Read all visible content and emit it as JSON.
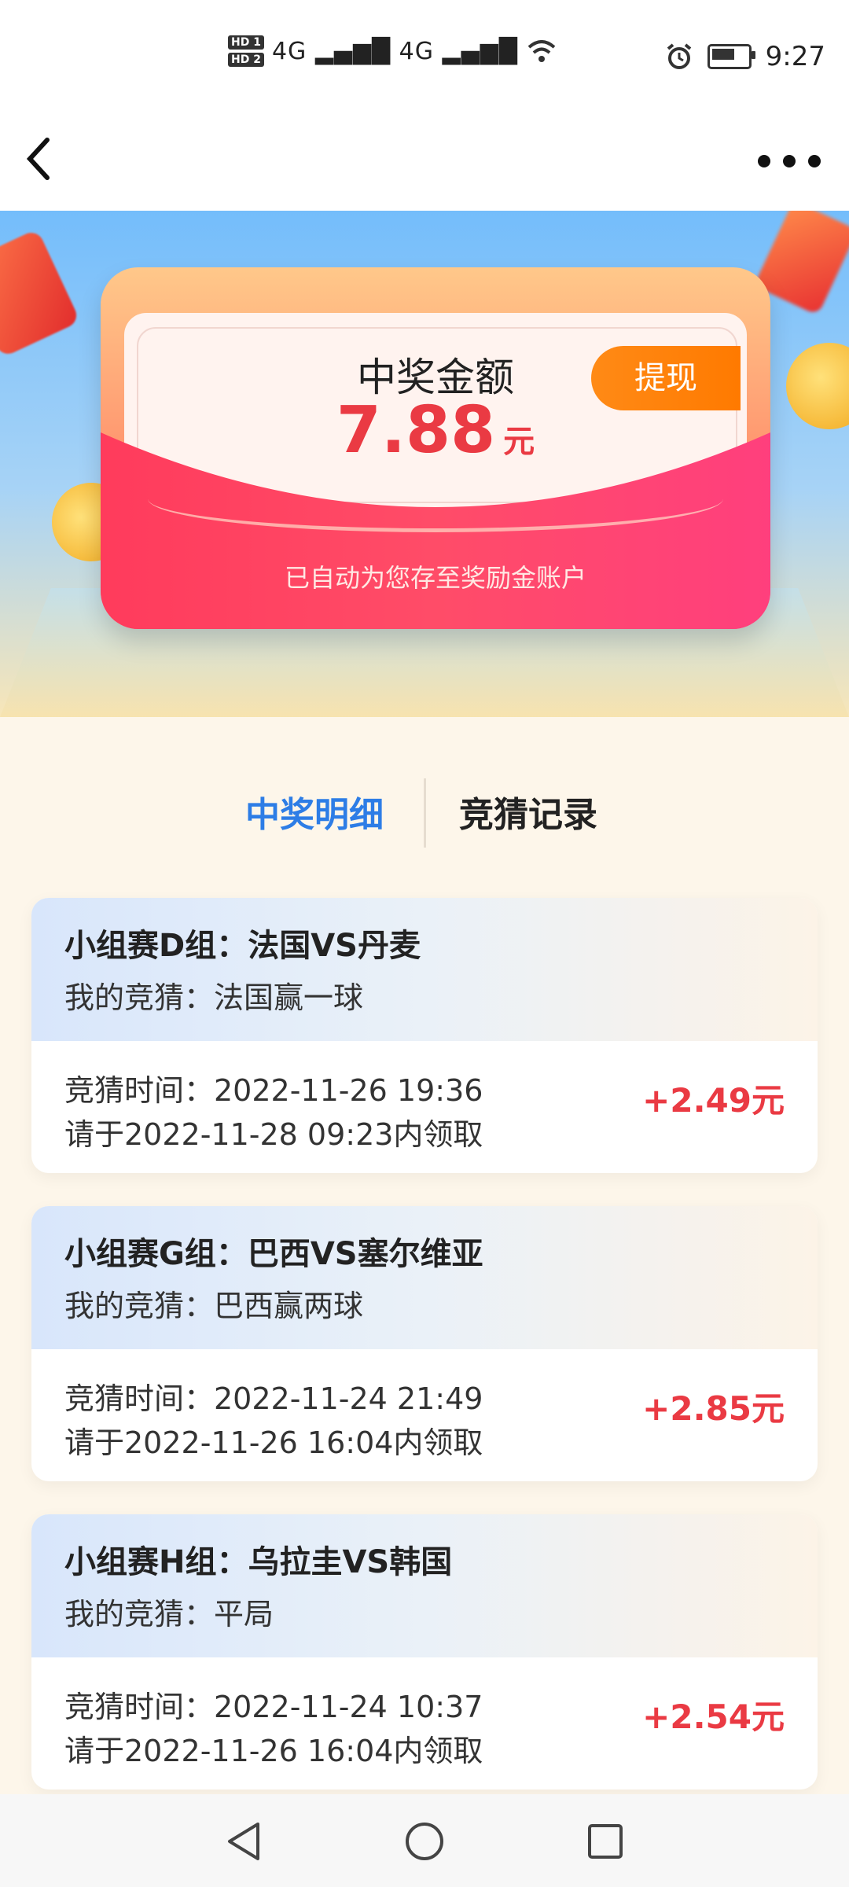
{
  "status_bar": {
    "hd1": "HD 1",
    "hd2": "HD 2",
    "signal": "4G ▂▄▆█ 4G ▂▄▆█",
    "time": "9:27"
  },
  "nav": {
    "back_icon": "chevron-left-icon",
    "more_icon": "more-dots-icon"
  },
  "prize": {
    "title": "中奖金额",
    "amount": "7.88",
    "unit": "元",
    "withdraw_label": "提现",
    "note": "已自动为您存至奖励金账户"
  },
  "tabs": [
    {
      "label": "中奖明细",
      "active": true
    },
    {
      "label": "竞猜记录",
      "active": false
    }
  ],
  "records": [
    {
      "title": "小组赛D组：法国VS丹麦",
      "guess": "我的竞猜：法国赢一球",
      "time": "竞猜时间：2022-11-26 19:36",
      "claim": "请于2022-11-28 09:23内领取",
      "amount": "+2.49元"
    },
    {
      "title": "小组赛G组：巴西VS塞尔维亚",
      "guess": "我的竞猜：巴西赢两球",
      "time": "竞猜时间：2022-11-24 21:49",
      "claim": "请于2022-11-26 16:04内领取",
      "amount": "+2.85元"
    },
    {
      "title": "小组赛H组：乌拉圭VS韩国",
      "guess": "我的竞猜：平局",
      "time": "竞猜时间：2022-11-24 10:37",
      "claim": "请于2022-11-26 16:04内领取",
      "amount": "+2.54元"
    }
  ],
  "colors": {
    "accent_blue": "#2d7de6",
    "amount_red": "#ea3a43",
    "withdraw_orange": "#ff7a00"
  }
}
